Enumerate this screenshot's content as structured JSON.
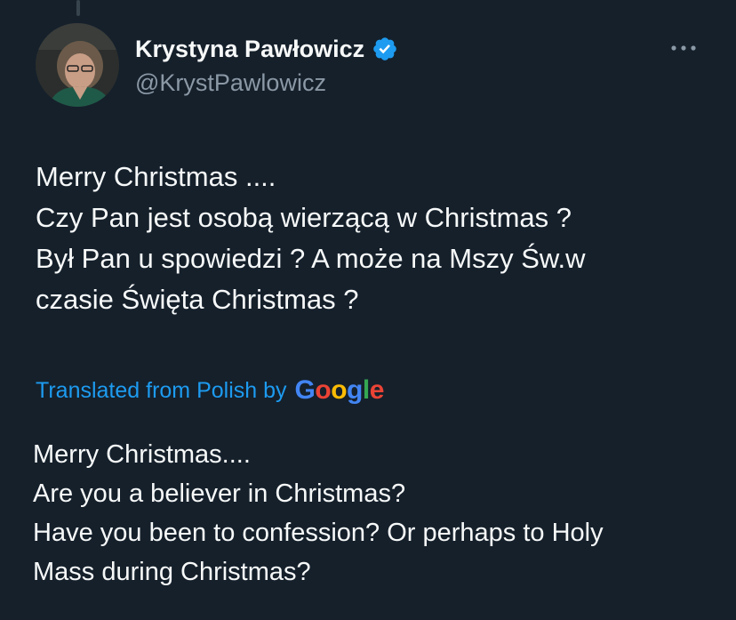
{
  "author": {
    "display_name": "Krystyna Pawłowicz",
    "handle": "@KrystPawlowicz",
    "verified": true,
    "avatar_icon": "profile-photo-icon"
  },
  "menu": {
    "icon": "more-options-icon"
  },
  "tweet": {
    "lines": [
      "Merry Christmas ....",
      "Czy Pan jest osobą wierzącą w Christmas ?",
      "Był Pan u spowiedzi ? A może na Mszy Św.w",
      "czasie Święta Christmas ?"
    ]
  },
  "translation": {
    "label": "Translated from Polish by",
    "provider": "Google",
    "provider_letters": [
      {
        "ch": "G",
        "color": "#4285f4"
      },
      {
        "ch": "o",
        "color": "#ea4335"
      },
      {
        "ch": "o",
        "color": "#fbbc05"
      },
      {
        "ch": "g",
        "color": "#4285f4"
      },
      {
        "ch": "l",
        "color": "#34a853"
      },
      {
        "ch": "e",
        "color": "#ea4335"
      }
    ],
    "lines": [
      "Merry Christmas....",
      "Are you a believer in Christmas?",
      "Have you been to confession? Or perhaps to Holy",
      "Mass during Christmas?"
    ]
  },
  "colors": {
    "background": "#15202b",
    "text_primary": "#f7f9f9",
    "text_secondary": "#8b98a5",
    "accent": "#1d9bf0"
  }
}
